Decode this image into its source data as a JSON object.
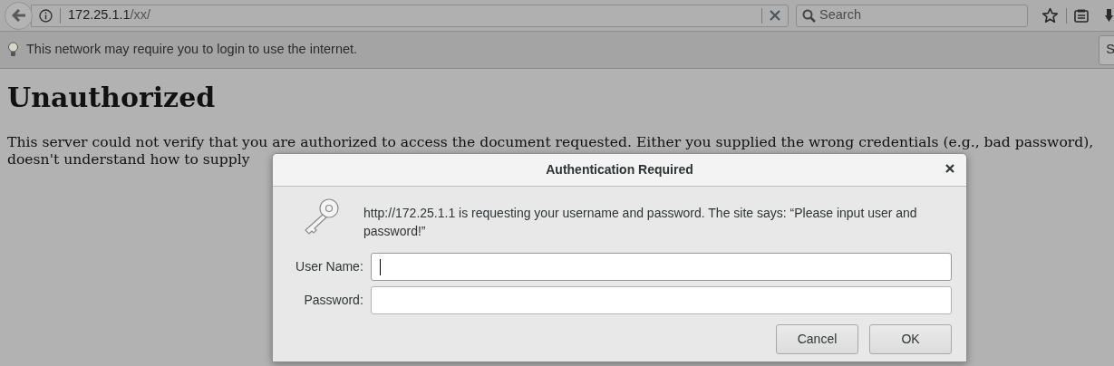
{
  "toolbar": {
    "url": {
      "host": "172.25.1.1",
      "path": "/xx/"
    },
    "search": {
      "placeholder": "Search"
    }
  },
  "notification": {
    "message": "This network may require you to login to use the internet.",
    "button": "S"
  },
  "page": {
    "heading": "Unauthorized",
    "lines": [
      "This server could not verify that you are authorized to access the document requested. Either you supplied the wrong credentials (e.g., bad password),",
      "doesn't understand how to supply"
    ]
  },
  "dialog": {
    "title": "Authentication Required",
    "message": "http://172.25.1.1 is requesting your username and password. The site says: “Please input user and password!”",
    "fields": [
      {
        "label": "User Name:",
        "focused": true
      },
      {
        "label": "Password:",
        "focused": false
      }
    ],
    "buttons": [
      "Cancel",
      "OK"
    ]
  }
}
